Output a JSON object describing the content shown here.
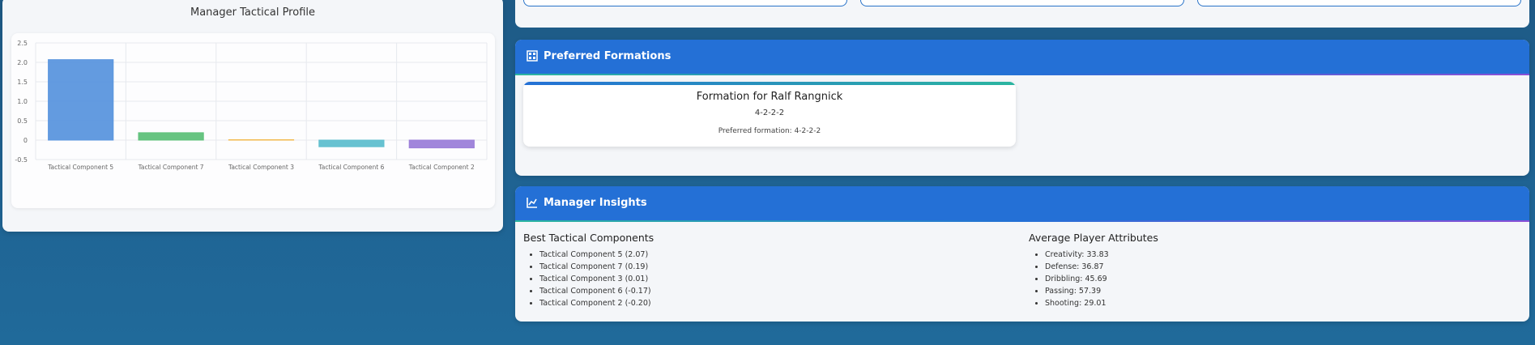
{
  "chart_panel": {
    "title": "Manager Tactical Profile"
  },
  "chart_data": {
    "type": "bar",
    "title": "",
    "categories": [
      "Tactical Component 5",
      "Tactical Component 7",
      "Tactical Component 3",
      "Tactical Component 6",
      "Tactical Component 2"
    ],
    "values": [
      2.07,
      0.19,
      0.01,
      -0.17,
      -0.2
    ],
    "colors": [
      "#5b96de",
      "#5fc17a",
      "#f2b94c",
      "#5fbfcf",
      "#9c7fd9"
    ],
    "ylim": [
      -0.5,
      2.5
    ],
    "yticks": [
      "2.5",
      "2.0",
      "1.5",
      "1.0",
      "0.5",
      "0",
      "-0.5"
    ],
    "grid": true,
    "legend": "none"
  },
  "formations": {
    "header": "Preferred Formations",
    "icon": "grid-icon",
    "card_title": "Formation for Ralf Rangnick",
    "card_code": "4-2-2-2",
    "card_pref": "Preferred formation: 4-2-2-2"
  },
  "insights": {
    "header": "Manager Insights",
    "icon": "chart-icon",
    "best_title": "Best Tactical Components",
    "best_items": [
      "Tactical Component 5 (2.07)",
      "Tactical Component 7 (0.19)",
      "Tactical Component 3 (0.01)",
      "Tactical Component 6 (-0.17)",
      "Tactical Component 2 (-0.20)"
    ],
    "avg_title": "Average Player Attributes",
    "avg_items": [
      "Creativity: 33.83",
      "Defense: 36.87",
      "Dribbling: 45.69",
      "Passing: 57.39",
      "Shooting: 29.01"
    ]
  },
  "colors": {
    "header_blue": "#2470d6",
    "background": "#1f6494"
  }
}
